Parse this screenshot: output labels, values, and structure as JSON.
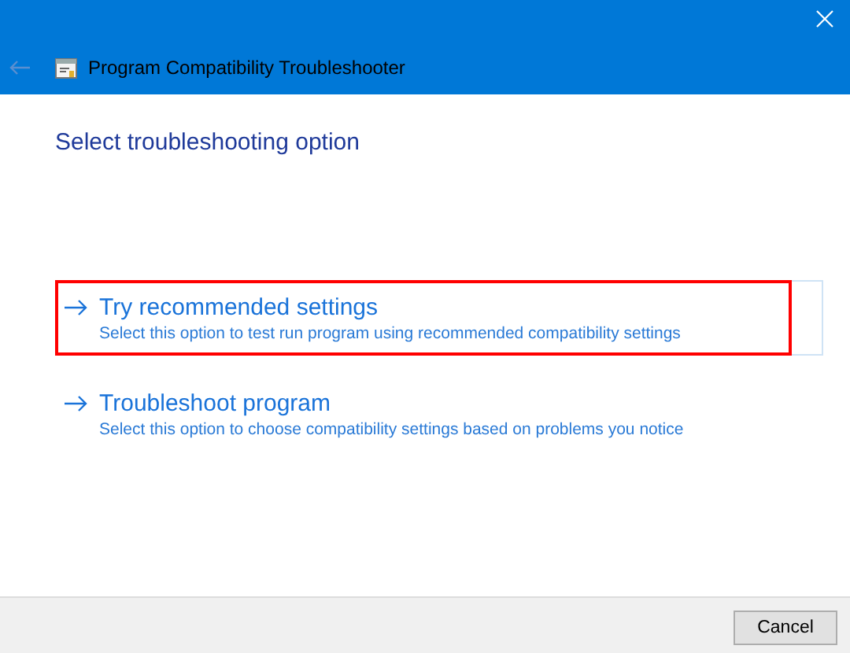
{
  "window": {
    "title": "Program Compatibility Troubleshooter"
  },
  "heading": "Select troubleshooting option",
  "options": [
    {
      "title": "Try recommended settings",
      "description": "Select this option to test run program using recommended compatibility settings",
      "selected": true,
      "highlighted": true
    },
    {
      "title": "Troubleshoot program",
      "description": "Select this option to choose compatibility settings based on problems you notice",
      "selected": false,
      "highlighted": false
    }
  ],
  "buttons": [
    "Cancel"
  ]
}
